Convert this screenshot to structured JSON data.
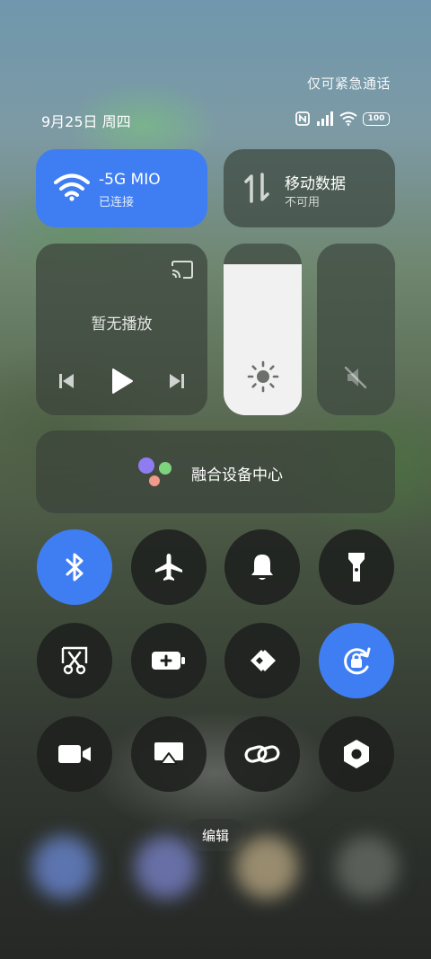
{
  "status_bar": {
    "emergency_text": "仅可紧急通话",
    "date": "9月25日 周四",
    "battery": "100",
    "icons": [
      "nfc-icon",
      "signal-icon",
      "wifi-icon",
      "battery-icon"
    ]
  },
  "wifi_tile": {
    "name": "-5G MIO",
    "status": "已连接",
    "active": true,
    "accent": "#3f7ef2"
  },
  "mobile_tile": {
    "name": "移动数据",
    "status": "不可用",
    "active": false
  },
  "media": {
    "title": "暂无播放",
    "icons": [
      "cast-icon",
      "previous-icon",
      "play-icon",
      "next-icon"
    ]
  },
  "brightness": {
    "level": 0.88
  },
  "volume": {
    "level": 0.0,
    "muted": true
  },
  "fusion_center": {
    "label": "融合设备中心"
  },
  "toggles": [
    {
      "name": "bluetooth",
      "icon": "bluetooth-icon",
      "on": true
    },
    {
      "name": "airplane-mode",
      "icon": "airplane-icon",
      "on": false
    },
    {
      "name": "ring-mode",
      "icon": "bell-icon",
      "on": false
    },
    {
      "name": "flashlight",
      "icon": "flashlight-icon",
      "on": false
    },
    {
      "name": "screenshot",
      "icon": "scissors-icon",
      "on": false
    },
    {
      "name": "battery-saver",
      "icon": "battery-plus-icon",
      "on": false
    },
    {
      "name": "nearby-share",
      "icon": "share-arrows-icon",
      "on": false
    },
    {
      "name": "rotation-lock",
      "icon": "rotation-lock-icon",
      "on": true
    },
    {
      "name": "screen-record",
      "icon": "video-camera-icon",
      "on": false
    },
    {
      "name": "screen-cast",
      "icon": "screen-cast-icon",
      "on": false
    },
    {
      "name": "link",
      "icon": "link-icon",
      "on": false
    },
    {
      "name": "settings",
      "icon": "hexagon-settings-icon",
      "on": false
    }
  ],
  "edit_label": "编辑"
}
